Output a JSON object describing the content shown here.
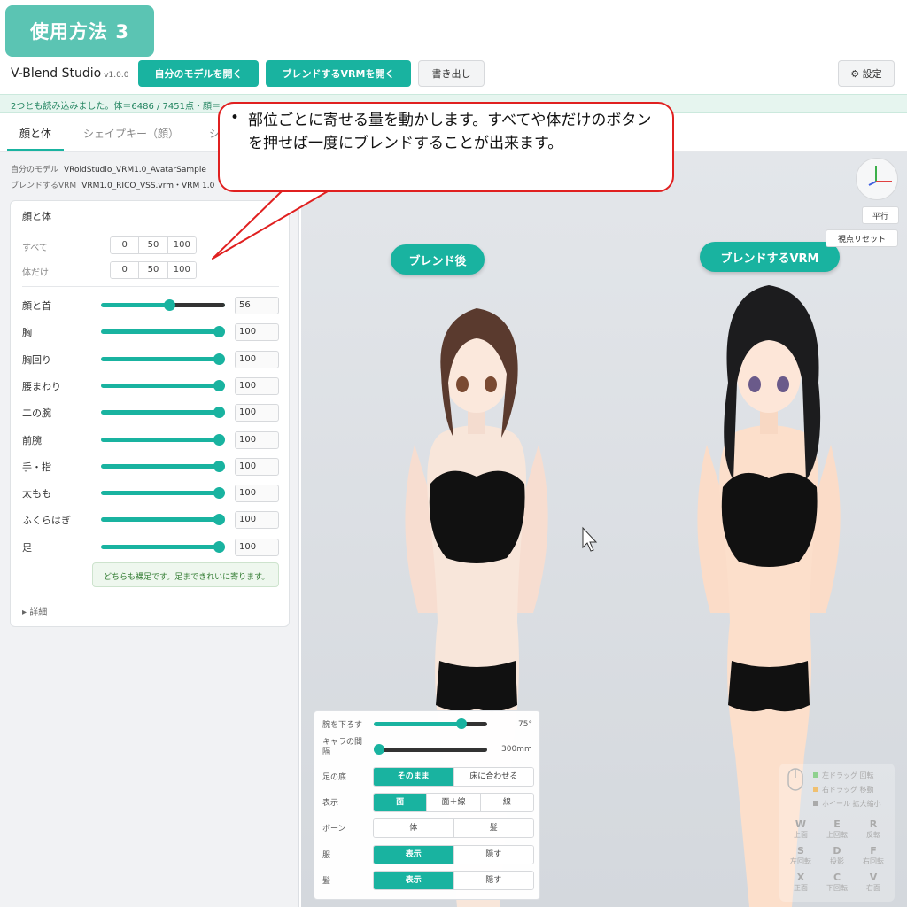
{
  "badge": {
    "title": "使用方法 3"
  },
  "app": {
    "name": "V-Blend Studio",
    "version": "v1.0.0"
  },
  "toolbar": {
    "open_own_label": "自分のモデルを開く",
    "open_blend_label": "ブレンドするVRMを開く",
    "export_label": "書き出し",
    "settings_label": "⚙ 設定"
  },
  "status": {
    "text": "2つとも読み込みました。体＝6486 / 7451点・顔＝"
  },
  "tabs": [
    {
      "label": "顔と体"
    },
    {
      "label": "シェイプキー（顔）"
    },
    {
      "label": "シ"
    }
  ],
  "meta": {
    "own_label": "自分のモデル",
    "own_value": "VRoidStudio_VRM1.0_AvatarSample",
    "blend_label": "ブレンドするVRM",
    "blend_value": "VRM1.0_RICO_VSS.vrm・VRM 1.0"
  },
  "panel": {
    "title": "顔と体",
    "all_label": "すべて",
    "body_only_label": "体だけ",
    "presets": [
      "0",
      "50",
      "100"
    ],
    "parts": [
      {
        "label": "顔と首",
        "value": "56",
        "fraction": 0.56
      },
      {
        "label": "胸",
        "value": "100",
        "fraction": 1
      },
      {
        "label": "胸回り",
        "value": "100",
        "fraction": 1
      },
      {
        "label": "腰まわり",
        "value": "100",
        "fraction": 1
      },
      {
        "label": "二の腕",
        "value": "100",
        "fraction": 1
      },
      {
        "label": "前腕",
        "value": "100",
        "fraction": 1
      },
      {
        "label": "手・指",
        "value": "100",
        "fraction": 1
      },
      {
        "label": "太もも",
        "value": "100",
        "fraction": 1
      },
      {
        "label": "ふくらはぎ",
        "value": "100",
        "fraction": 1
      },
      {
        "label": "足",
        "value": "100",
        "fraction": 1
      }
    ],
    "note": "どちらも裸足です。足まできれいに寄ります。",
    "details_label": "▸ 詳細"
  },
  "viewport": {
    "after_label": "ブレンド後",
    "blend_label": "ブレンドするVRM",
    "parallel_label": "平行",
    "reset_view_label": "視点リセット"
  },
  "controls": {
    "arm_label": "腕を下ろす",
    "arm_value": "75°",
    "arm_fraction": 0.8,
    "gap_label": "キャラの間隔",
    "gap_value": "300mm",
    "gap_fraction": 0,
    "feet_label": "足の底",
    "feet_options": [
      "そのまま",
      "床に合わせる"
    ],
    "display_label": "表示",
    "display_options": [
      "面",
      "面＋線",
      "線"
    ],
    "bone_label": "ボーン",
    "bone_options": [
      "体",
      "髪"
    ],
    "clothes_label": "服",
    "clothes_options": [
      "表示",
      "隠す"
    ],
    "hair_label": "髪",
    "hair_options": [
      "表示",
      "隠す"
    ]
  },
  "hints": {
    "left_drag": "左ドラッグ 回転",
    "right_drag": "右ドラッグ 移動",
    "wheel": "ホイール 拡大縮小",
    "keys": [
      {
        "key": "W",
        "label": "上面"
      },
      {
        "key": "E",
        "label": "上回転"
      },
      {
        "key": "R",
        "label": "反転"
      },
      {
        "key": "S",
        "label": "左回転"
      },
      {
        "key": "D",
        "label": "投影"
      },
      {
        "key": "F",
        "label": "右回転"
      },
      {
        "key": "X",
        "label": "正面"
      },
      {
        "key": "C",
        "label": "下回転"
      },
      {
        "key": "V",
        "label": "右面"
      }
    ]
  },
  "callout": {
    "bullet": "•",
    "text": "部位ごとに寄せる量を動かします。すべてや体だけのボタンを押せば一度にブレンドすることが出来ます。"
  },
  "colors": {
    "accent": "#19b3a0",
    "callout_border": "#e02020"
  }
}
